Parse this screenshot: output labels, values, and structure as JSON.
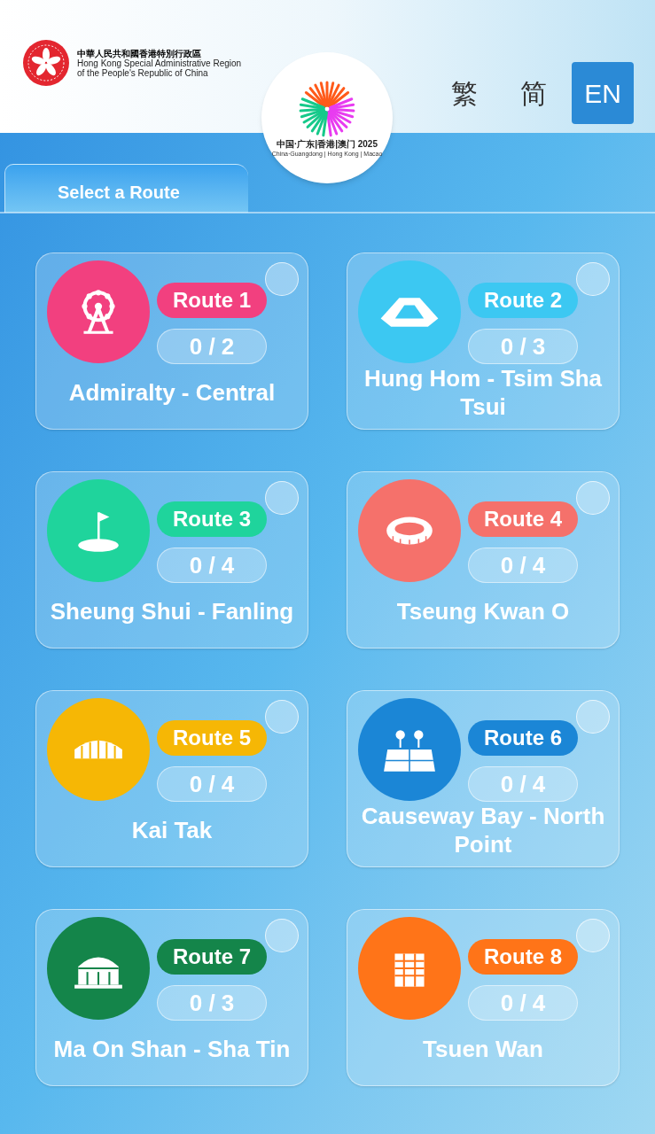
{
  "header": {
    "gov_name_zh": "中華人民共和國香港特別行政區",
    "gov_name_en_1": "Hong Kong Special Administrative Region",
    "gov_name_en_2": "of the People's Republic of China",
    "logo_text_zh": "中国·广东|香港|澳门 2025",
    "logo_text_en": "China·Guangdong | Hong Kong | Macao"
  },
  "languages": [
    {
      "label": "繁",
      "selected": false
    },
    {
      "label": "简",
      "selected": false
    },
    {
      "label": "EN",
      "selected": true
    }
  ],
  "tab": {
    "label": "Select a Route"
  },
  "routes": [
    {
      "label": "Route 1",
      "progress": "0 / 2",
      "name": "Admiralty - Central",
      "color": "#f2407f",
      "selected": false
    },
    {
      "label": "Route 2",
      "progress": "0 / 3",
      "name": "Hung Hom - Tsim Sha Tsui",
      "color": "#3cc8f2",
      "selected": false
    },
    {
      "label": "Route 3",
      "progress": "0 / 4",
      "name": "Sheung Shui - Fanling",
      "color": "#1fd49c",
      "selected": false
    },
    {
      "label": "Route 4",
      "progress": "0 / 4",
      "name": "Tseung Kwan O",
      "color": "#f5716b",
      "selected": false
    },
    {
      "label": "Route 5",
      "progress": "0 / 4",
      "name": "Kai Tak",
      "color": "#f6b705",
      "selected": false
    },
    {
      "label": "Route 6",
      "progress": "0 / 4",
      "name": "Causeway Bay - North Point",
      "color": "#1b86d6",
      "selected": false
    },
    {
      "label": "Route 7",
      "progress": "0 / 3",
      "name": "Ma On Shan - Sha Tin",
      "color": "#14854a",
      "selected": false
    },
    {
      "label": "Route 8",
      "progress": "0 / 4",
      "name": "Tsuen Wan",
      "color": "#ff7418",
      "selected": false
    }
  ]
}
